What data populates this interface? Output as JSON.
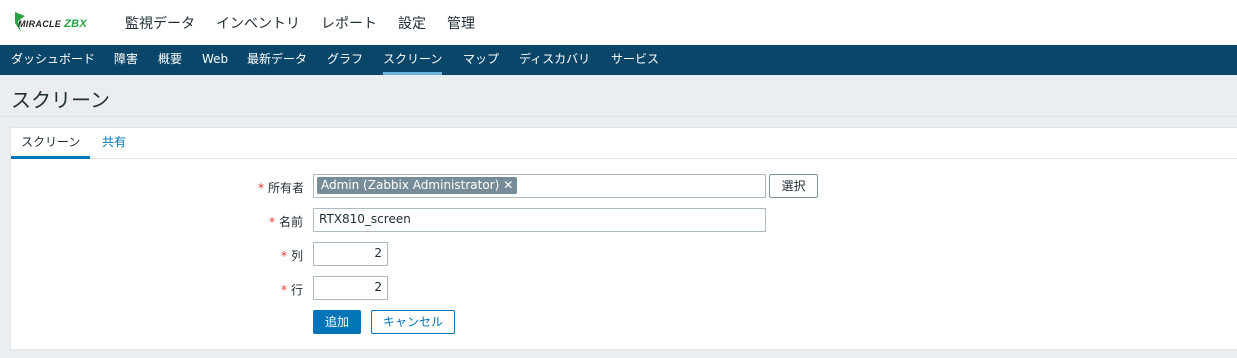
{
  "logo": {
    "text_main": "MIRACLE",
    "text_accent": "ZBX"
  },
  "main_nav": [
    "監視データ",
    "インベントリ",
    "レポート",
    "設定",
    "管理"
  ],
  "sub_nav": {
    "items": [
      "ダッシュボード",
      "障害",
      "概要",
      "Web",
      "最新データ",
      "グラフ",
      "スクリーン",
      "マップ",
      "ディスカバリ",
      "サービス"
    ],
    "active": "スクリーン"
  },
  "page": {
    "title": "スクリーン"
  },
  "tabs": [
    {
      "label": "スクリーン",
      "active": true
    },
    {
      "label": "共有",
      "active": false
    }
  ],
  "form": {
    "required_mark": "*",
    "owner": {
      "label": "所有者",
      "value": "Admin (Zabbix Administrator)",
      "select_label": "選択"
    },
    "name": {
      "label": "名前",
      "value": "RTX810_screen"
    },
    "columns": {
      "label": "列",
      "value": "2"
    },
    "rows": {
      "label": "行",
      "value": "2"
    },
    "add_label": "追加",
    "cancel_label": "キャンセル"
  },
  "colors": {
    "nav_bg": "#0a466a",
    "accent": "#0275b8",
    "required": "#e33734",
    "chip": "#768d99"
  }
}
